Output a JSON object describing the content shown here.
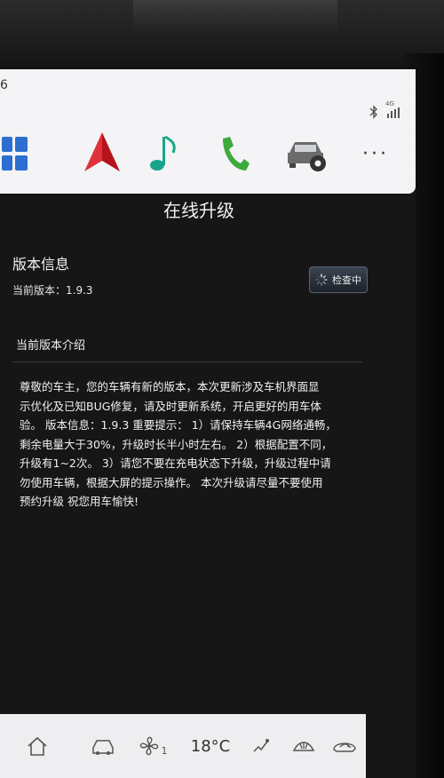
{
  "topbar": {
    "edge_text": "6",
    "status": {
      "network_label": "4G"
    },
    "nav": [
      {
        "name": "apps",
        "icon": "grid-icon"
      },
      {
        "name": "navigation",
        "icon": "navigation-arrow-icon"
      },
      {
        "name": "music",
        "icon": "music-note-icon"
      },
      {
        "name": "phone",
        "icon": "phone-icon"
      },
      {
        "name": "vehicle-settings",
        "icon": "car-gear-icon"
      },
      {
        "name": "more",
        "icon": "more-icon",
        "label": "···"
      }
    ]
  },
  "page": {
    "title": "在线升级"
  },
  "version_info": {
    "heading": "版本信息",
    "current_version": "当前版本：1.9.3",
    "check_button_label": "检查中"
  },
  "intro": {
    "heading": "当前版本介绍",
    "body_lines": [
      "尊敬的车主，您的车辆有新的版本，本次更新涉及车机界面显",
      "示优化及已知BUG修复，请及时更新系统，开启更好的用车体",
      "验。 版本信息：1.9.3 重要提示： 1）请保持车辆4G网络通畅，",
      "剩余电量大于30%，升级时长半小时左右。 2）根据配置不同，",
      "升级有1~2次。 3）请您不要在充电状态下升级，升级过程中请",
      "勿使用车辆，根据大屏的提示操作。 本次升级请尽量不要使用",
      "预约升级 祝您用车愉快!"
    ]
  },
  "bottombar": {
    "fan_level": "1",
    "temperature": "18°C",
    "items": [
      {
        "name": "home",
        "icon": "home-icon"
      },
      {
        "name": "car",
        "icon": "car-icon"
      },
      {
        "name": "fan",
        "icon": "fan-icon"
      },
      {
        "name": "temperature",
        "icon": "temperature-display"
      },
      {
        "name": "airflow",
        "icon": "airflow-icon"
      },
      {
        "name": "front-defrost",
        "icon": "defrost-icon"
      },
      {
        "name": "recirculation",
        "icon": "recirculation-icon"
      }
    ]
  },
  "colors": {
    "screen_bg": "#161616",
    "bar_bg": "#f4f4f6",
    "nav_red": "#d8202a",
    "music_teal": "#1aa58a",
    "phone_green": "#3caa3c",
    "text": "#f0f0f0"
  }
}
